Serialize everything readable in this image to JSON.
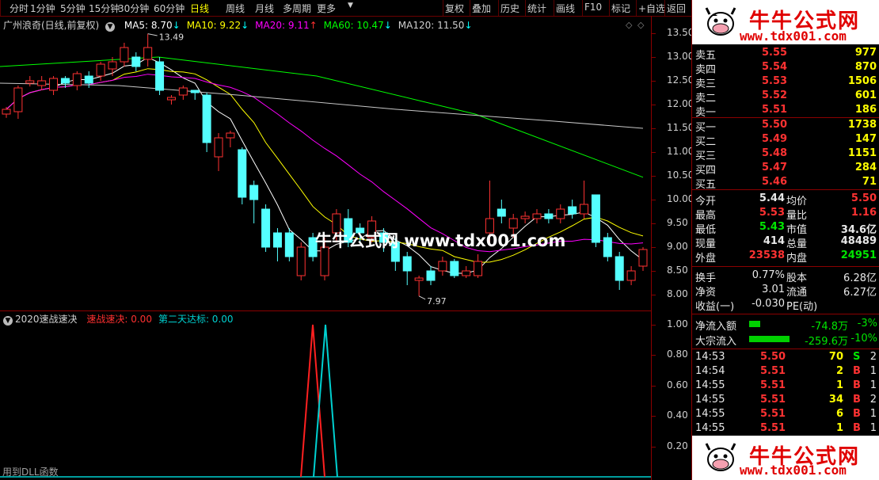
{
  "toolbar": {
    "timeframes": [
      "分时",
      "1分钟",
      "5分钟",
      "15分钟",
      "30分钟",
      "60分钟",
      "日线",
      "周线",
      "月线",
      "多周期",
      "更多"
    ],
    "active": "日线",
    "actions": [
      "复权",
      "叠加",
      "历史",
      "统计",
      "画线",
      "F10",
      "标记",
      "+自选",
      "返回"
    ]
  },
  "main_chart": {
    "title": "广州浪奇(日线,前复权)",
    "legend": [
      {
        "label": "MA5: 8.70",
        "arrow": "↓",
        "color": "#ffffff"
      },
      {
        "label": "MA10: 9.22",
        "arrow": "↓",
        "color": "#ffff00"
      },
      {
        "label": "MA20: 9.11",
        "arrow": "↑",
        "color": "#ff00ff"
      },
      {
        "label": "MA60: 10.47",
        "arrow": "↓",
        "color": "#00ff00"
      },
      {
        "label": "MA120: 11.50",
        "arrow": "↓",
        "color": "#d0d0d0"
      }
    ],
    "high_marker": "13.49",
    "low_marker": "7.97",
    "yaxis": [
      "13.50",
      "13.00",
      "12.50",
      "12.00",
      "11.50",
      "11.00",
      "10.50",
      "10.00",
      "9.50",
      "9.00",
      "8.50",
      "8.00"
    ]
  },
  "sub_chart": {
    "title": "2020速战速决",
    "legend": [
      {
        "label": "速战速决: 0.00",
        "color": "#ff3030"
      },
      {
        "label": "第二天达标: 0.00",
        "color": "#00d0d0"
      }
    ],
    "yaxis": [
      "1.00",
      "0.80",
      "0.60",
      "0.40",
      "0.20"
    ],
    "footer": "用到DLL函数"
  },
  "watermark": "牛牛公式网 www.tdx001.com",
  "brand": {
    "title": "牛牛公式网",
    "url": "www.tdx001.com"
  },
  "orderbook": {
    "asks": [
      {
        "label": "卖五",
        "price": "5.55",
        "vol": "977"
      },
      {
        "label": "卖四",
        "price": "5.54",
        "vol": "870"
      },
      {
        "label": "卖三",
        "price": "5.53",
        "vol": "1506"
      },
      {
        "label": "卖二",
        "price": "5.52",
        "vol": "601"
      },
      {
        "label": "卖一",
        "price": "5.51",
        "vol": "186"
      }
    ],
    "bids": [
      {
        "label": "买一",
        "price": "5.50",
        "vol": "1738"
      },
      {
        "label": "买二",
        "price": "5.49",
        "vol": "147"
      },
      {
        "label": "买三",
        "price": "5.48",
        "vol": "1151"
      },
      {
        "label": "买四",
        "price": "5.47",
        "vol": "284"
      },
      {
        "label": "买五",
        "price": "5.46",
        "vol": "71"
      }
    ]
  },
  "stats": [
    {
      "l1": "今开",
      "v1": "5.44",
      "c1": "white",
      "l2": "均价",
      "v2": "5.50",
      "c2": "red"
    },
    {
      "l1": "最高",
      "v1": "5.53",
      "c1": "red",
      "l2": "量比",
      "v2": "1.16",
      "c2": "red"
    },
    {
      "l1": "最低",
      "v1": "5.43",
      "c1": "green",
      "l2": "市值",
      "v2": "34.6亿",
      "c2": "white"
    },
    {
      "l1": "现量",
      "v1": "414",
      "c1": "white",
      "l2": "总量",
      "v2": "48489",
      "c2": "white"
    },
    {
      "l1": "外盘",
      "v1": "23538",
      "c1": "red",
      "l2": "内盘",
      "v2": "24951",
      "c2": "green"
    }
  ],
  "stats2": [
    {
      "l1": "换手",
      "v1": "0.77%",
      "l2": "股本",
      "v2": "6.28亿"
    },
    {
      "l1": "净资",
      "v1": "3.01",
      "l2": "流通",
      "v2": "6.27亿"
    },
    {
      "l1": "收益(一)",
      "v1": "-0.030",
      "l2": "PE(动)",
      "v2": ""
    }
  ],
  "flows": [
    {
      "label": "净流入额",
      "value": "-74.8万",
      "pct": "-3%",
      "bar": 0.25
    },
    {
      "label": "大宗流入",
      "value": "-259.6万",
      "pct": "-10%",
      "bar": 0.95
    }
  ],
  "ticks": [
    {
      "time": "14:53",
      "price": "5.50",
      "vol": "70",
      "side": "S",
      "n": "2"
    },
    {
      "time": "14:54",
      "price": "5.51",
      "vol": "2",
      "side": "B",
      "n": "1"
    },
    {
      "time": "14:55",
      "price": "5.51",
      "vol": "1",
      "side": "B",
      "n": "1"
    },
    {
      "time": "14:55",
      "price": "5.51",
      "vol": "34",
      "side": "B",
      "n": "2"
    },
    {
      "time": "14:55",
      "price": "5.51",
      "vol": "6",
      "side": "B",
      "n": "1"
    },
    {
      "time": "14:55",
      "price": "5.51",
      "vol": "1",
      "side": "B",
      "n": "1"
    }
  ],
  "candles": [
    [
      11.8,
      11.9,
      11.72,
      11.95
    ],
    [
      11.85,
      12.35,
      11.7,
      12.4
    ],
    [
      12.45,
      12.5,
      12.38,
      12.6
    ],
    [
      12.4,
      12.5,
      12.3,
      12.6
    ],
    [
      12.3,
      12.55,
      12.2,
      12.6
    ],
    [
      12.55,
      12.45,
      12.35,
      12.6
    ],
    [
      12.4,
      12.65,
      12.3,
      12.7
    ],
    [
      12.6,
      12.45,
      12.35,
      12.7
    ],
    [
      12.6,
      12.85,
      12.5,
      12.9
    ],
    [
      12.75,
      12.9,
      12.6,
      13.0
    ],
    [
      12.9,
      13.2,
      12.8,
      13.3
    ],
    [
      13.0,
      12.8,
      12.7,
      13.1
    ],
    [
      12.95,
      13.2,
      12.8,
      13.49
    ],
    [
      12.9,
      12.3,
      12.2,
      13.0
    ],
    [
      12.1,
      12.15,
      12.0,
      12.2
    ],
    [
      12.2,
      12.35,
      12.1,
      12.4
    ],
    [
      12.3,
      12.25,
      12.1,
      12.3
    ],
    [
      12.2,
      11.2,
      11.0,
      12.25
    ],
    [
      10.9,
      11.3,
      10.6,
      11.4
    ],
    [
      11.3,
      11.4,
      11.1,
      11.45
    ],
    [
      11.05,
      10.05,
      9.9,
      11.1
    ],
    [
      10.3,
      10.0,
      9.5,
      10.4
    ],
    [
      9.8,
      9.0,
      8.9,
      9.9
    ],
    [
      9.3,
      9.0,
      8.7,
      9.4
    ],
    [
      9.3,
      8.8,
      8.7,
      9.4
    ],
    [
      8.4,
      9.0,
      8.3,
      9.1
    ],
    [
      9.2,
      8.8,
      8.7,
      9.3
    ],
    [
      8.4,
      9.0,
      8.3,
      9.2
    ],
    [
      9.3,
      9.7,
      9.1,
      9.8
    ],
    [
      9.6,
      9.1,
      9.0,
      9.8
    ],
    [
      9.4,
      9.3,
      9.1,
      9.5
    ],
    [
      9.2,
      9.55,
      9.1,
      9.65
    ],
    [
      9.3,
      9.1,
      8.9,
      9.4
    ],
    [
      9.1,
      8.7,
      8.5,
      9.2
    ],
    [
      8.8,
      8.5,
      8.2,
      8.9
    ],
    [
      8.3,
      8.35,
      7.97,
      8.4
    ],
    [
      8.5,
      8.3,
      8.2,
      8.6
    ],
    [
      8.5,
      8.7,
      8.4,
      8.8
    ],
    [
      8.7,
      8.4,
      8.35,
      8.75
    ],
    [
      8.4,
      8.5,
      8.35,
      8.6
    ],
    [
      8.4,
      8.7,
      8.35,
      8.85
    ],
    [
      9.3,
      9.6,
      9.1,
      10.4
    ],
    [
      9.8,
      9.65,
      9.5,
      10.0
    ],
    [
      9.4,
      9.6,
      9.2,
      9.7
    ],
    [
      9.6,
      9.65,
      9.5,
      9.75
    ],
    [
      9.6,
      9.7,
      9.5,
      9.8
    ],
    [
      9.7,
      9.6,
      9.5,
      9.8
    ],
    [
      9.6,
      9.8,
      9.5,
      9.9
    ],
    [
      9.85,
      9.7,
      9.6,
      10.0
    ],
    [
      9.7,
      9.9,
      9.6,
      10.4
    ],
    [
      10.1,
      9.1,
      9.0,
      10.1
    ],
    [
      9.2,
      8.8,
      8.7,
      9.3
    ],
    [
      8.8,
      8.3,
      8.1,
      8.9
    ],
    [
      8.3,
      8.5,
      8.2,
      8.6
    ],
    [
      8.6,
      8.95,
      8.5,
      9.0
    ]
  ]
}
